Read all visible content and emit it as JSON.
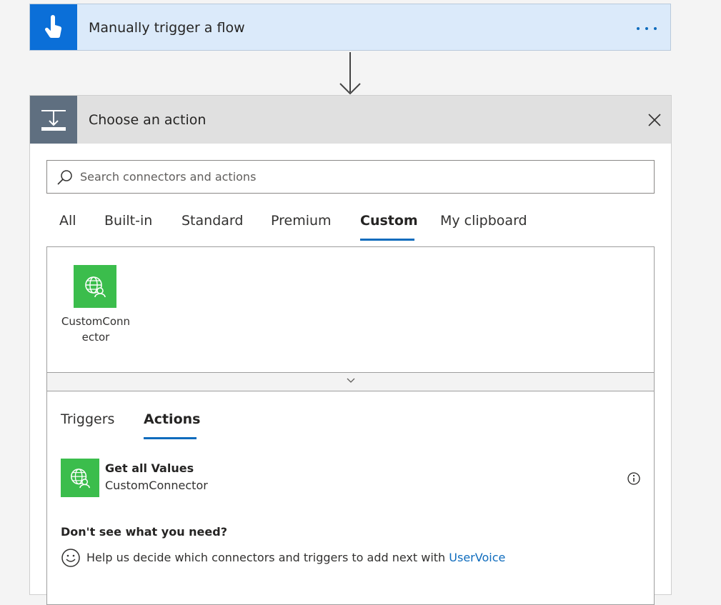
{
  "trigger": {
    "title": "Manually trigger a flow",
    "icon": "hand-touch-icon",
    "accent": "#0b6fd8"
  },
  "action_panel": {
    "title": "Choose an action",
    "icon": "insert-step-icon",
    "search": {
      "placeholder": "Search connectors and actions",
      "value": ""
    },
    "tabs": [
      {
        "label": "All"
      },
      {
        "label": "Built-in"
      },
      {
        "label": "Standard"
      },
      {
        "label": "Premium"
      },
      {
        "label": "Custom",
        "active": true
      },
      {
        "label": "My clipboard"
      }
    ],
    "connectors": [
      {
        "label": "CustomConnector",
        "icon": "globe-user-icon",
        "color": "#3bbd4c"
      }
    ],
    "subtabs": [
      {
        "label": "Triggers"
      },
      {
        "label": "Actions",
        "active": true
      }
    ],
    "actions": [
      {
        "name": "Get all Values",
        "connector": "CustomConnector",
        "icon": "globe-user-icon"
      }
    ],
    "help": {
      "title": "Don't see what you need?",
      "text": "Help us decide which connectors and triggers to add next with",
      "link": "UserVoice"
    }
  }
}
